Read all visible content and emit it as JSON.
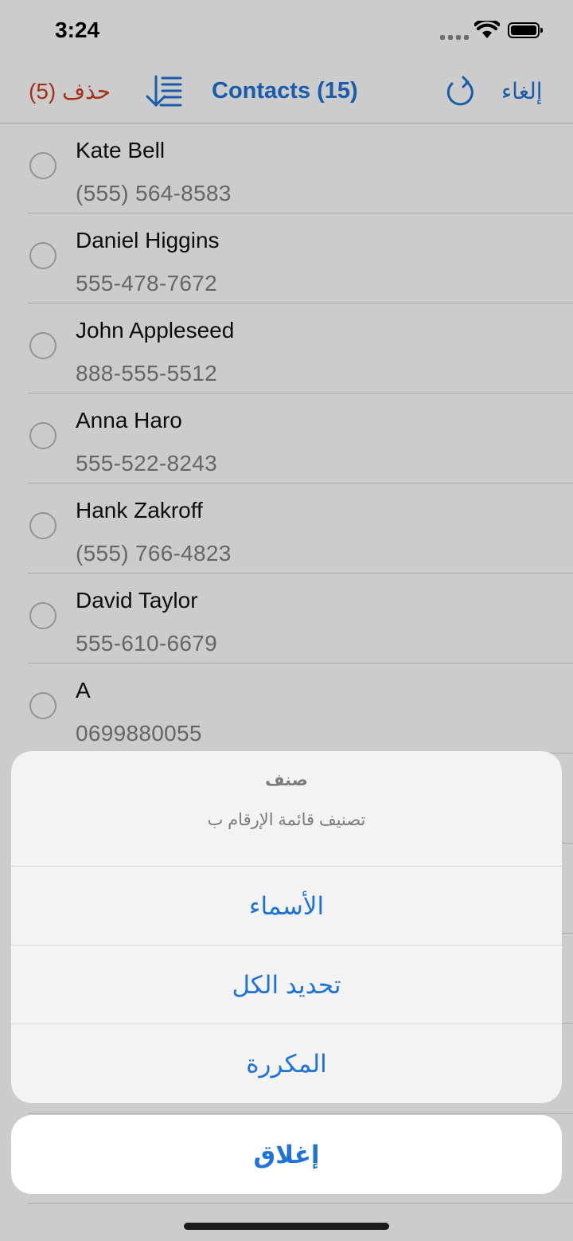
{
  "status_bar": {
    "time": "3:24"
  },
  "navbar": {
    "delete_label": "حذف (5)",
    "title": "Contacts (15)",
    "cancel_label": "إلغاء"
  },
  "contacts": [
    {
      "name": "Kate Bell",
      "phone": "(555) 564-8583"
    },
    {
      "name": "Daniel Higgins",
      "phone": "555-478-7672"
    },
    {
      "name": "John Appleseed",
      "phone": "888-555-5512"
    },
    {
      "name": "Anna Haro",
      "phone": "555-522-8243"
    },
    {
      "name": "Hank Zakroff",
      "phone": "(555) 766-4823"
    },
    {
      "name": "David Taylor",
      "phone": "555-610-6679"
    },
    {
      "name": "A",
      "phone": "0699880055"
    }
  ],
  "action_sheet": {
    "title": "صنف",
    "message": "تصنيف قائمة الإرقام ب",
    "options": [
      "الأسماء",
      "تحديد الكل",
      "المكررة"
    ],
    "close_label": "إغلاق"
  },
  "colors": {
    "accent": "#1f73d6",
    "destructive": "#d13b1e"
  },
  "icons": [
    "sort-icon",
    "refresh-icon",
    "wifi-icon",
    "battery-icon",
    "signal-icon"
  ]
}
